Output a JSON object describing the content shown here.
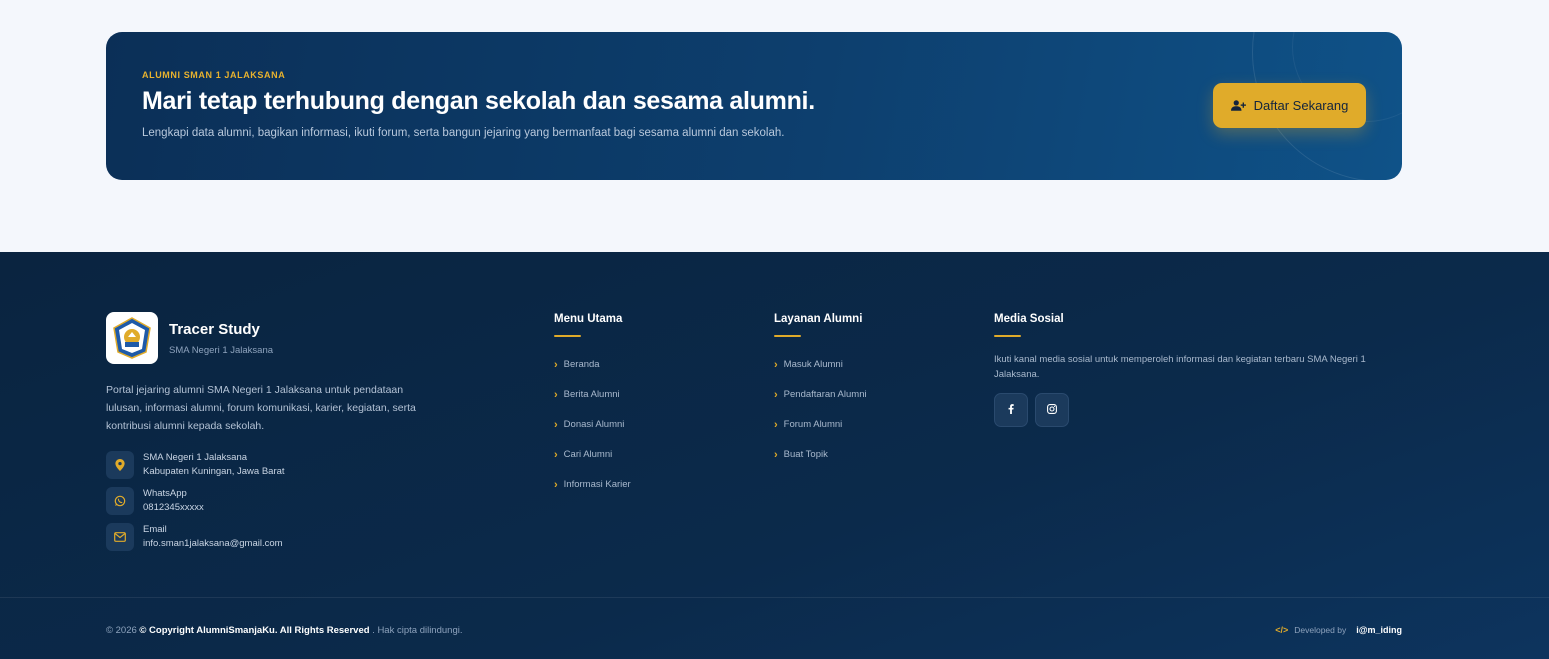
{
  "cta": {
    "eyebrow": "ALUMNI SMAN 1 JALAKSANA",
    "title": "Mari tetap terhubung dengan sekolah dan sesama alumni.",
    "description": "Lengkapi data alumni, bagikan informasi, ikuti forum, serta bangun jejaring yang bermanfaat bagi sesama alumni dan sekolah.",
    "button_label": "Daftar Sekarang",
    "button_icon": "user-plus-icon"
  },
  "brand": {
    "name": "Tracer Study",
    "subtitle": "SMA Negeri 1 Jalaksana",
    "description": "Portal jejaring alumni SMA Negeri 1 Jalaksana untuk pendataan lulusan, informasi alumni, forum komunikasi, karier, kegiatan, serta kontribusi alumni kepada sekolah."
  },
  "contacts": [
    {
      "icon": "map-pin-icon",
      "line1": "SMA Negeri 1 Jalaksana",
      "line2": "Kabupaten Kuningan, Jawa Barat"
    },
    {
      "icon": "whatsapp-icon",
      "line1": "WhatsApp",
      "line2": "0812345xxxxx"
    },
    {
      "icon": "mail-icon",
      "line1": "Email",
      "line2": "info.sman1jalaksana@gmail.com"
    }
  ],
  "menu_utama": {
    "title": "Menu Utama",
    "links": [
      "Beranda",
      "Berita Alumni",
      "Donasi Alumni",
      "Cari Alumni",
      "Informasi Karier"
    ]
  },
  "layanan_alumni": {
    "title": "Layanan Alumni",
    "links": [
      "Masuk Alumni",
      "Pendaftaran Alumni",
      "Forum Alumni",
      "Buat Topik"
    ]
  },
  "media_sosial": {
    "title": "Media Sosial",
    "description": "Ikuti kanal media sosial untuk memperoleh informasi dan kegiatan terbaru SMA Negeri 1 Jalaksana.",
    "icons": [
      "facebook-icon",
      "instagram-icon"
    ]
  },
  "bottom": {
    "year_prefix": "© 2026",
    "copyright": "© Copyright AlumniSmanjaKu. All Rights Reserved",
    "suffix": ". Hak cipta dilindungi.",
    "developed_by": "Developed by",
    "developer": "i@m_iding"
  },
  "colors": {
    "accent": "#e0ab2a",
    "footer_bg": "#0b2a4b",
    "page_bg": "#f4f7fc"
  }
}
